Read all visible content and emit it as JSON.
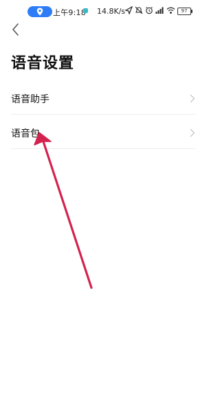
{
  "status_bar": {
    "time": "上午9:18",
    "speed": "14.8K/s",
    "battery": "97",
    "icons": [
      "location-icon",
      "send-icon",
      "mute-icon",
      "alarm-icon",
      "signal-icon",
      "wifi-icon",
      "battery-icon"
    ]
  },
  "header": {
    "back_icon": "chevron-left-icon",
    "title": "语音设置"
  },
  "settings": {
    "items": [
      {
        "label": "语音助手",
        "icon": "chevron-right-icon"
      },
      {
        "label": "语音包",
        "icon": "chevron-right-icon"
      }
    ]
  },
  "annotation": {
    "arrow_color": "#d3224e"
  },
  "colors": {
    "accent": "#2f7df6",
    "divider": "#eeeeee"
  }
}
